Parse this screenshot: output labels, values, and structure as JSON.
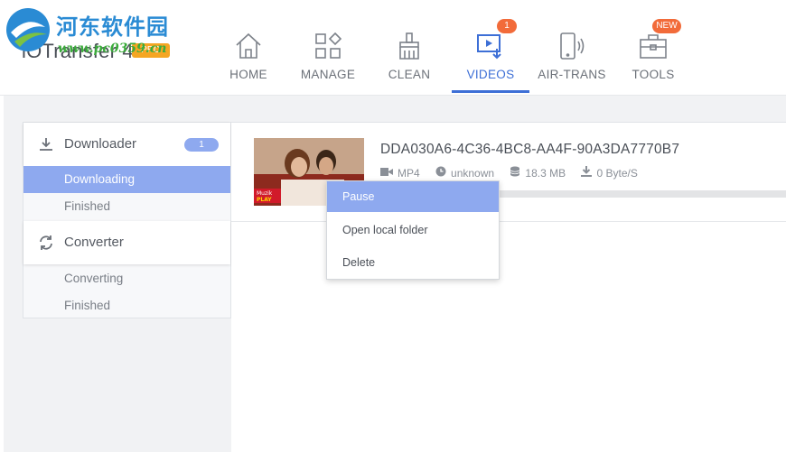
{
  "app": {
    "title": "iOTransfer 4",
    "badge": "PRO"
  },
  "watermark": {
    "text": "河东软件园",
    "url": "www.pc0359.cn"
  },
  "nav": {
    "items": [
      {
        "label": "HOME",
        "icon": "home-icon"
      },
      {
        "label": "MANAGE",
        "icon": "manage-icon"
      },
      {
        "label": "CLEAN",
        "icon": "clean-brush-icon"
      },
      {
        "label": "VIDEOS",
        "icon": "video-download-icon",
        "badge": "1",
        "active": true
      },
      {
        "label": "AIR-TRANS",
        "icon": "phone-wireless-icon"
      },
      {
        "label": "TOOLS",
        "icon": "toolbox-icon",
        "badge": "NEW"
      }
    ]
  },
  "sidebar": {
    "downloader": {
      "label": "Downloader",
      "count": "1",
      "icon": "download-icon"
    },
    "downloader_items": [
      {
        "label": "Downloading",
        "active": true
      },
      {
        "label": "Finished"
      }
    ],
    "converter": {
      "label": "Converter",
      "icon": "refresh-icon"
    },
    "converter_items": [
      {
        "label": "Converting"
      },
      {
        "label": "Finished"
      }
    ]
  },
  "download": {
    "file_name": "DDA030A6-4C36-4BC8-AA4F-90A3DA7770B7",
    "format": "MP4",
    "duration": "unknown",
    "size": "18.3 MB",
    "speed": "0 Byte/S",
    "thumbnail_logo": "Muzik PLAY",
    "progress": 0.0
  },
  "context_menu": {
    "items": [
      {
        "label": "Pause",
        "active": true
      },
      {
        "label": "Open local folder"
      },
      {
        "label": "Delete"
      }
    ]
  },
  "colors": {
    "accent": "#3d6fd6",
    "selection": "#8ea9ef",
    "badge": "#f26b3a"
  }
}
